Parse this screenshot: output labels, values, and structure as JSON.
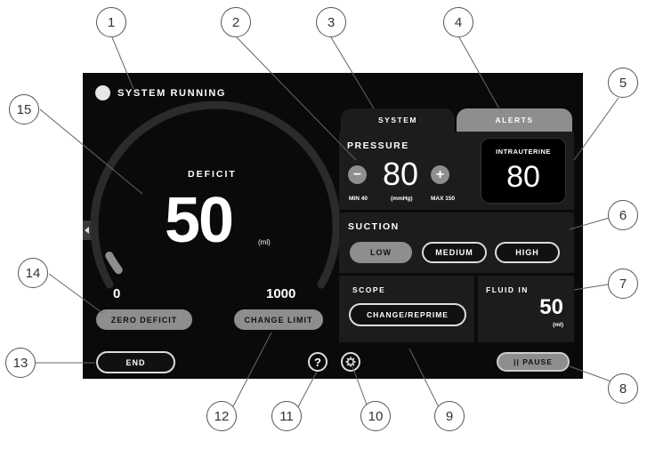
{
  "status": {
    "text": "SYSTEM RUNNING"
  },
  "deficit": {
    "label": "DEFICIT",
    "value": "50",
    "unit": "(ml)",
    "min": "0",
    "limit": "1000",
    "fill_fraction": 0.05
  },
  "buttons": {
    "zero_deficit": "ZERO DEFICIT",
    "change_limit": "CHANGE LIMIT",
    "end": "END",
    "help": "?",
    "pause": "|| PAUSE"
  },
  "tabs": {
    "system": "SYSTEM",
    "alerts": "ALERTS"
  },
  "pressure": {
    "label": "PRESSURE",
    "value": "80",
    "unit": "(mmHg)",
    "min": "MIN 40",
    "max": "MAX 150",
    "decrease": "−",
    "increase": "+"
  },
  "intrauterine": {
    "label": "INTRAUTERINE",
    "value": "80"
  },
  "suction": {
    "label": "SUCTION",
    "options": [
      "LOW",
      "MEDIUM",
      "HIGH"
    ],
    "selected": "LOW"
  },
  "scope": {
    "label": "SCOPE",
    "button": "CHANGE/REPRIME"
  },
  "fluid_in": {
    "label": "FLUID IN",
    "value": "50",
    "unit": "(ml)"
  },
  "callouts": [
    "1",
    "2",
    "3",
    "4",
    "5",
    "6",
    "7",
    "8",
    "9",
    "10",
    "11",
    "12",
    "13",
    "14",
    "15"
  ],
  "colors": {
    "screen_bg": "#0a0a0a",
    "panel_bg": "#1c1c1c",
    "accent_gray": "#8e8e8e",
    "text": "#ffffff"
  },
  "icons": {
    "status": "status-dot-icon",
    "collapse": "caret-left-icon",
    "settings": "gear-icon"
  }
}
